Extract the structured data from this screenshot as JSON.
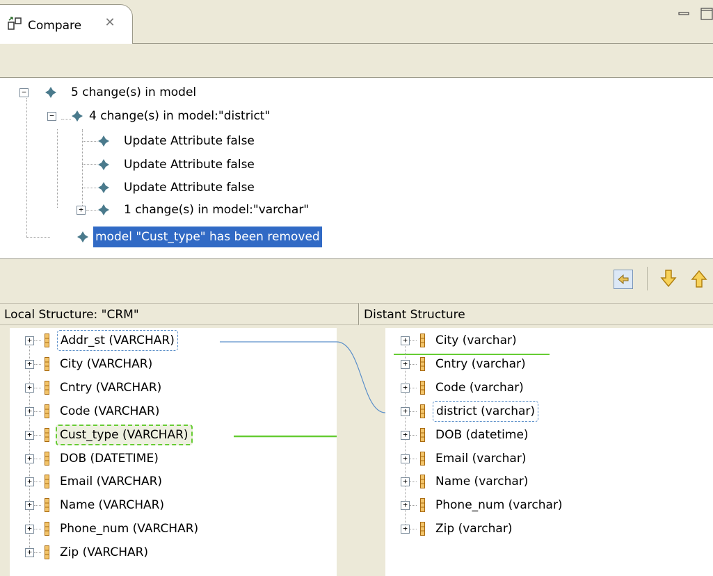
{
  "tab": {
    "title": "Compare",
    "icon": "compare-icon",
    "close_icon": "close-icon"
  },
  "changes": [
    {
      "label": "5 change(s) in model",
      "level": 0,
      "toggle": "minus"
    },
    {
      "label": "4 change(s) in model:\"district\"",
      "level": 1,
      "toggle": "minus"
    },
    {
      "label": "Update Attribute false",
      "level": 2,
      "toggle": "none"
    },
    {
      "label": "Update Attribute false",
      "level": 2,
      "toggle": "none"
    },
    {
      "label": "Update Attribute false",
      "level": 2,
      "toggle": "none"
    },
    {
      "label": "1 change(s) in model:\"varchar\"",
      "level": 2,
      "toggle": "plus"
    },
    {
      "label": "model \"Cust_type\" has been removed",
      "level": 1,
      "toggle": "none",
      "selected": true
    }
  ],
  "headers": {
    "left": "Local Structure: \"CRM\"",
    "right": "Distant Structure"
  },
  "local_columns": [
    "Addr_st (VARCHAR)",
    "City (VARCHAR)",
    "Cntry (VARCHAR)",
    "Code (VARCHAR)",
    "Cust_type (VARCHAR)",
    "DOB (DATETIME)",
    "Email (VARCHAR)",
    "Name (VARCHAR)",
    "Phone_num (VARCHAR)",
    "Zip (VARCHAR)"
  ],
  "distant_columns": [
    "City (varchar)",
    "Cntry (varchar)",
    "Code (varchar)",
    "district (varchar)",
    "DOB (datetime)",
    "Email (varchar)",
    "Name (varchar)",
    "Phone_num (varchar)",
    "Zip (varchar)"
  ],
  "colors": {
    "selection": "#316ac5",
    "added_removed": "#66cc33",
    "mapping_line": "#5b8fc9",
    "column_icon": "#d08a2a",
    "diamond": "#4a7a8c"
  },
  "nav": {
    "copy_icon": "copy-left-icon",
    "down_icon": "arrow-down-icon",
    "up_icon": "arrow-up-icon"
  }
}
